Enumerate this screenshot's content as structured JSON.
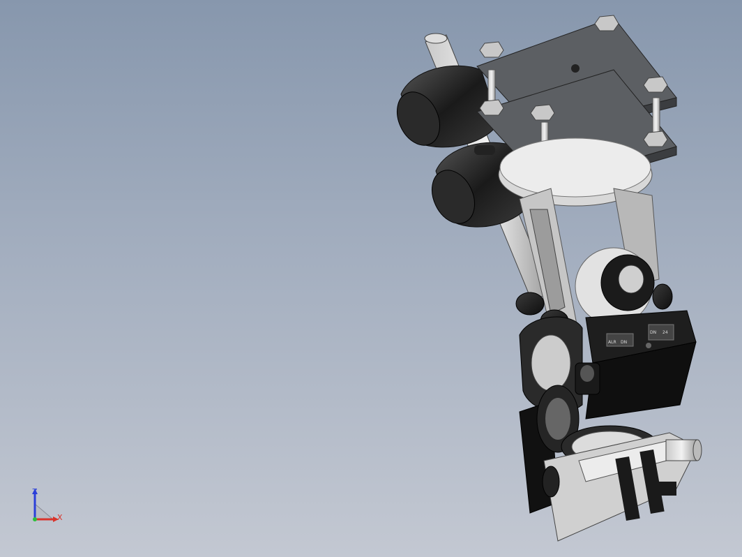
{
  "window": {
    "title": "",
    "background_top": "#8797ad",
    "background_bottom": "#c3c8d2"
  },
  "triad": {
    "x_label": "X",
    "z_label": "Z",
    "x_color": "#d9342b",
    "y_color": "#2bbf3a",
    "z_color": "#2b3fd9"
  },
  "model": {
    "description_icon": "cad-assembly-icon",
    "panel_labels": [
      "ALR",
      "DN",
      "DN",
      "24"
    ]
  }
}
